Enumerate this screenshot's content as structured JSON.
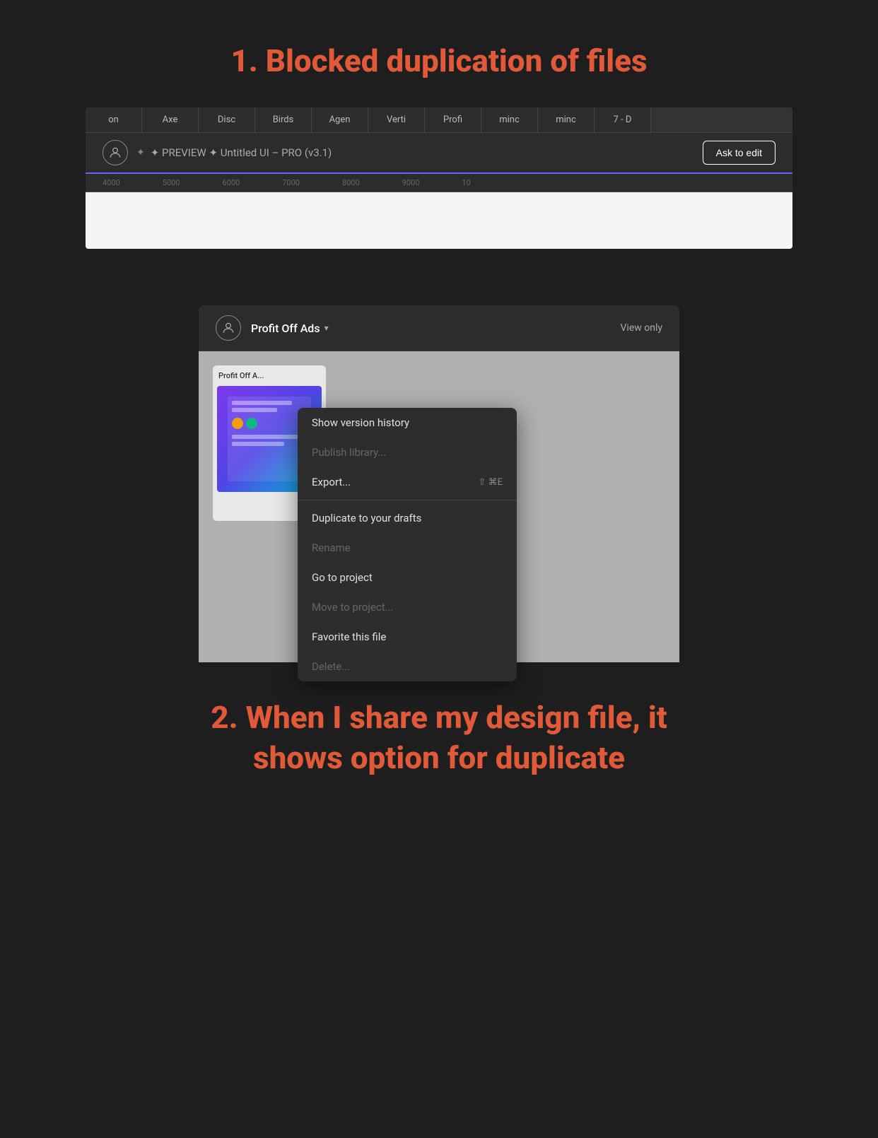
{
  "section1": {
    "title": "1.  Blocked duplication of files",
    "tabs": [
      {
        "label": "on"
      },
      {
        "label": "Axe"
      },
      {
        "label": "Disc"
      },
      {
        "label": "Birds"
      },
      {
        "label": "Agen"
      },
      {
        "label": "Verti"
      },
      {
        "label": "Profi"
      },
      {
        "label": "minc"
      },
      {
        "label": "minc"
      },
      {
        "label": "7 - D"
      }
    ],
    "toolbar": {
      "preview_text": "✦ PREVIEW ✦ Untitled UI – PRO (v3.1)",
      "ask_to_edit": "Ask to edit"
    },
    "ruler": {
      "ticks": [
        "4000",
        "5000",
        "6000",
        "7000",
        "8000",
        "9000",
        "10"
      ]
    }
  },
  "section2": {
    "figma_header": {
      "title": "Profit Off Ads",
      "view_only": "View only"
    },
    "dropdown": {
      "items": [
        {
          "label": "Show version history",
          "shortcut": "",
          "disabled": false
        },
        {
          "label": "Publish library...",
          "shortcut": "",
          "disabled": true
        },
        {
          "label": "Export...",
          "shortcut": "⇧ ⌘E",
          "disabled": false
        },
        {
          "divider": true
        },
        {
          "label": "Duplicate to your drafts",
          "shortcut": "",
          "disabled": false
        },
        {
          "label": "Rename",
          "shortcut": "",
          "disabled": true
        },
        {
          "label": "Go to project",
          "shortcut": "",
          "disabled": false
        },
        {
          "label": "Move to project...",
          "shortcut": "",
          "disabled": true
        },
        {
          "label": "Favorite this file",
          "shortcut": "",
          "disabled": false
        },
        {
          "label": "Delete...",
          "shortcut": "",
          "disabled": true
        }
      ]
    },
    "file_card": {
      "label": "Profit Off A..."
    },
    "title": "2.  When I share my design file, it shows option for duplicate"
  }
}
